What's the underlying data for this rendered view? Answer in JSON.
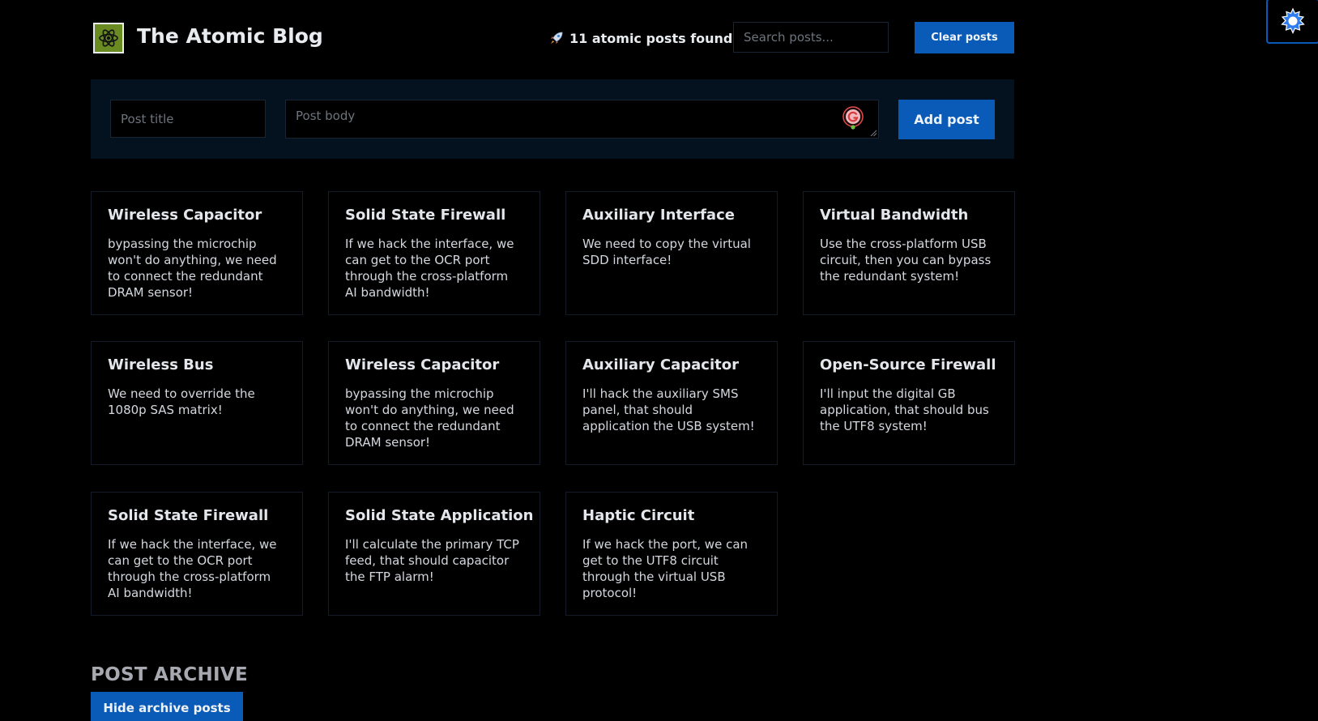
{
  "header": {
    "title": "The Atomic Blog",
    "logo_icon": "atom-icon",
    "posts_found_icon": "rocket-icon",
    "posts_found_text": "11 atomic posts found",
    "search_placeholder": "Search posts...",
    "clear_label": "Clear posts"
  },
  "form": {
    "title_placeholder": "Post title",
    "body_placeholder": "Post body",
    "add_label": "Add post"
  },
  "posts": [
    {
      "title": "Wireless Capacitor",
      "body": "bypassing the microchip won't do anything, we need to connect the redundant DRAM sensor!"
    },
    {
      "title": "Solid State Firewall",
      "body": "If we hack the interface, we can get to the OCR port through the cross-platform AI bandwidth!"
    },
    {
      "title": "Auxiliary Interface",
      "body": "We need to copy the virtual SDD interface!"
    },
    {
      "title": "Virtual Bandwidth",
      "body": "Use the cross-platform USB circuit, then you can bypass the redundant system!"
    },
    {
      "title": "Wireless Bus",
      "body": "We need to override the 1080p SAS matrix!"
    },
    {
      "title": "Wireless Capacitor",
      "body": "bypassing the microchip won't do anything, we need to connect the redundant DRAM sensor!"
    },
    {
      "title": "Auxiliary Capacitor",
      "body": "I'll hack the auxiliary SMS panel, that should application the USB system!"
    },
    {
      "title": "Open-Source Firewall",
      "body": "I'll input the digital GB application, that should bus the UTF8 system!"
    },
    {
      "title": "Solid State Firewall",
      "body": "If we hack the interface, we can get to the OCR port through the cross-platform AI bandwidth!"
    },
    {
      "title": "Solid State Application",
      "body": "I'll calculate the primary TCP feed, that should capacitor the FTP alarm!"
    },
    {
      "title": "Haptic Circuit",
      "body": "If we hack the port, we can get to the UTF8 circuit through the virtual USB protocol!"
    }
  ],
  "archive": {
    "heading": "POST ARCHIVE",
    "hide_label": "Hide archive posts"
  },
  "theme_toggle_icon": "sun-icon",
  "colors": {
    "background": "#000000",
    "accent": "#0a5ab8",
    "panel": "#04111f",
    "logo_green": "#6a8b22"
  }
}
